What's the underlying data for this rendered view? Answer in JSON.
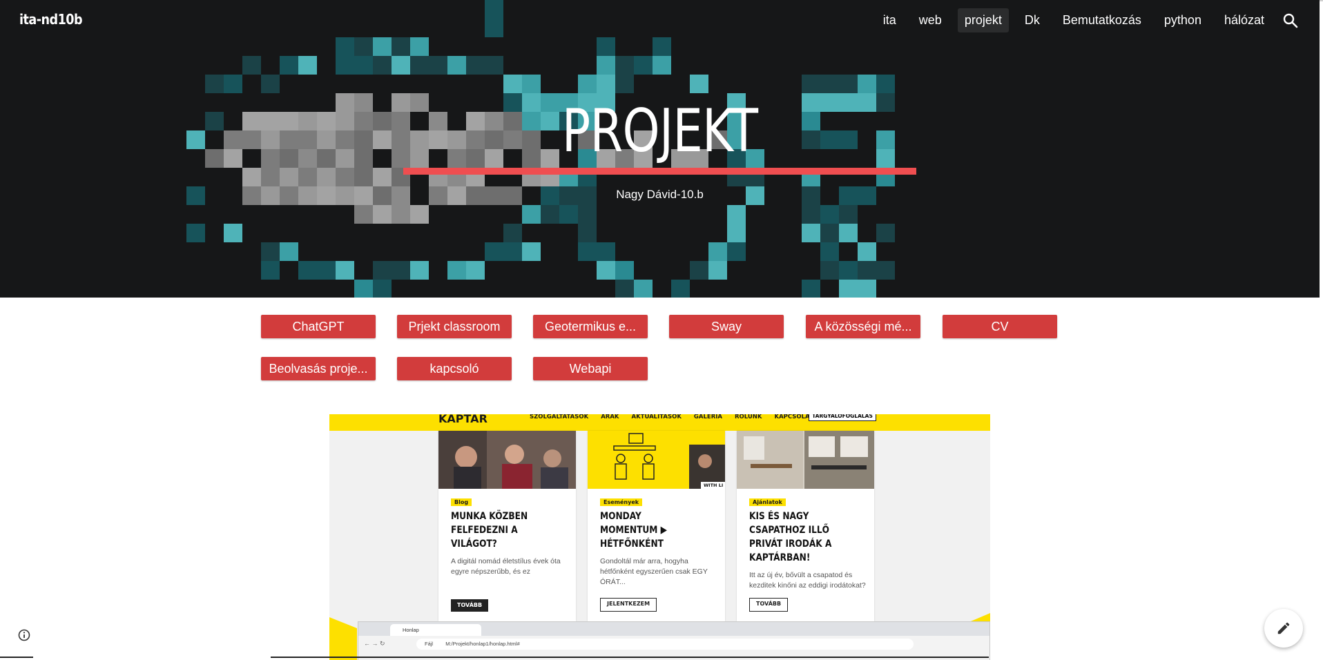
{
  "site": {
    "title": "ita-nd10b"
  },
  "nav": {
    "items": [
      {
        "label": "ita",
        "active": false
      },
      {
        "label": "web",
        "active": false
      },
      {
        "label": "projekt",
        "active": true
      },
      {
        "label": "Dk",
        "active": false
      },
      {
        "label": "Bemutatkozás",
        "active": false
      },
      {
        "label": "python",
        "active": false
      },
      {
        "label": "hálózat",
        "active": false
      }
    ],
    "search_icon": "search-icon"
  },
  "hero": {
    "title": "PROJEKT",
    "subtitle": "Nagy Dávid-10.b",
    "accent_color": "#ef4e50"
  },
  "buttons": [
    {
      "label": "ChatGPT"
    },
    {
      "label": "Prjekt classroom"
    },
    {
      "label": "Geotermikus e..."
    },
    {
      "label": "Sway"
    },
    {
      "label": "A közösségi mé..."
    },
    {
      "label": "CV"
    },
    {
      "label": "Beolvasás proje..."
    },
    {
      "label": "kapcsoló"
    },
    {
      "label": "Webapi"
    }
  ],
  "button_color": "#d23c3c",
  "embed": {
    "logo": "KAPTÁR",
    "nav_links": [
      "SZOLGÁLTATÁSOK",
      "ÁRAK",
      "AKTUALITÁSOK",
      "GALÉRIA",
      "RÓLUNK",
      "KAPCSOLAT"
    ],
    "book_button": "TÁRGYALÓFOGLALÁS",
    "cards": [
      {
        "tag": "Blog",
        "title": "MUNKA KÖZBEN FELFEDEZNI A VILÁGOT?",
        "text": "A digitál nomád életstílus évek óta egyre népszerűbb, és ez",
        "button": "TOVÁBB"
      },
      {
        "tag": "Események",
        "title": "MONDAY MOMENTUM ▶ HÉTFŐNKÉNT",
        "text": "Gondoltál már arra, hogyha hétfőnként egyszerűen csak EGY ÓRÁT...",
        "button": "JELENTKEZEM"
      },
      {
        "tag": "Ajánlatok",
        "title": "KIS ÉS NAGY CSAPATHOZ ILLŐ PRIVÁT IRODÁK A KAPTÁRBAN!",
        "text": "Itt az új év, bővült a csapatod és kezditek kinőni az eddigi irodátokat?",
        "button": "TOVÁBB"
      }
    ],
    "image_caption": "WITH LI",
    "browser": {
      "tab_label": "Honlap",
      "address_prefix": "Fájl",
      "address": "M:/Projekt/honlap1/honlap.html#"
    }
  },
  "footer": {
    "info_icon": "info-icon",
    "edit_icon": "pencil-icon"
  }
}
